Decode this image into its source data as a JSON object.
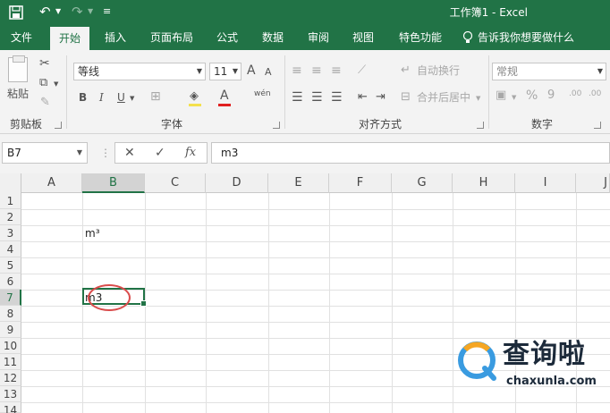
{
  "titlebar": {
    "save_icon": "save-icon",
    "undo_glyph": "↶",
    "redo_glyph": "↷",
    "customize_glyph": "≡",
    "title": "工作簿1  -  Excel"
  },
  "tabs": [
    "文件",
    "开始",
    "插入",
    "页面布局",
    "公式",
    "数据",
    "审阅",
    "视图",
    "特色功能"
  ],
  "tell_me": "告诉我你想要做什么",
  "ribbon": {
    "clipboard": {
      "paste_label": "粘贴",
      "group_label": "剪贴板"
    },
    "font": {
      "font_name": "等线",
      "font_size": "11",
      "grow": "A",
      "shrink": "A",
      "bold": "B",
      "italic": "I",
      "underline": "U",
      "font_color": "A",
      "wen": "wén",
      "group_label": "字体"
    },
    "alignment": {
      "wrap_text": "自动换行",
      "merge_center": "合并后居中",
      "group_label": "对齐方式"
    },
    "number": {
      "format": "常规",
      "percent": "%",
      "comma": "9",
      "inc_dec": ".00",
      "dec_dec": ".00",
      "group_label": "数字"
    }
  },
  "formula_bar": {
    "name_box": "B7",
    "cancel": "✕",
    "enter": "✓",
    "fx": "fx",
    "content": "m3"
  },
  "columns": [
    "A",
    "B",
    "C",
    "D",
    "E",
    "F",
    "G",
    "H",
    "I",
    "J"
  ],
  "rows": [
    "1",
    "2",
    "3",
    "4",
    "5",
    "6",
    "7",
    "8",
    "9",
    "10",
    "11",
    "12",
    "13",
    "14"
  ],
  "cells": {
    "B3": "m³",
    "B7": "m3"
  },
  "colors": {
    "excel_green": "#217346",
    "annotation_red": "#d94c4c"
  },
  "watermark": {
    "name": "查询啦",
    "url": "chaxunla.com"
  }
}
